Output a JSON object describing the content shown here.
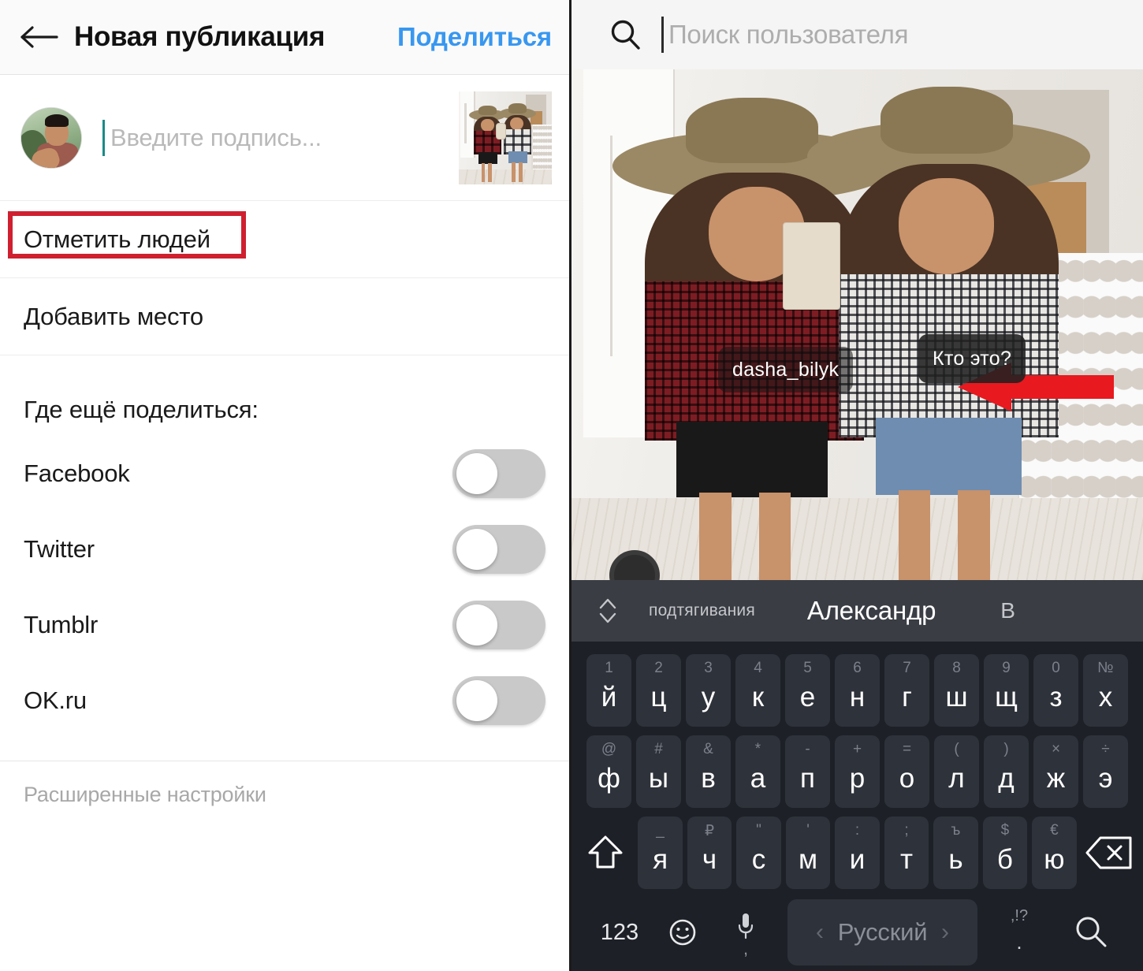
{
  "left": {
    "topbar": {
      "back_icon": "back-arrow-icon",
      "title": "Новая публикация",
      "share_label": "Поделиться"
    },
    "caption": {
      "avatar_name": "user-avatar",
      "placeholder": "Введите подпись...",
      "thumbnail_name": "post-thumbnail"
    },
    "menu": [
      {
        "label": "Отметить людей",
        "highlighted": true
      },
      {
        "label": "Добавить место",
        "highlighted": false
      }
    ],
    "share_section": {
      "label": "Где ещё поделиться:",
      "toggles": [
        {
          "label": "Facebook",
          "on": false
        },
        {
          "label": "Twitter",
          "on": false
        },
        {
          "label": "Tumblr",
          "on": false
        },
        {
          "label": "OK.ru",
          "on": false
        }
      ]
    },
    "advanced_label": "Расширенные настройки",
    "highlight_color": "#cf2030",
    "accent_color": "#3897f0"
  },
  "right": {
    "search": {
      "icon": "search-icon",
      "placeholder": "Поиск пользователя",
      "value": ""
    },
    "photo": {
      "tags": [
        {
          "label": "dasha_bilyk",
          "name": "photo-tag-dasha-bilyk"
        },
        {
          "label": "Кто это?",
          "name": "photo-tag-who-is-this"
        }
      ],
      "annotation": {
        "name": "red-arrow-annotation",
        "color": "#e8191f"
      }
    },
    "keyboard": {
      "suggestions": [
        {
          "text": "подтягивания"
        },
        {
          "text": "Александр"
        },
        {
          "text": "В"
        }
      ],
      "expand_icon": "chevron-up-down-icon",
      "rows": [
        [
          {
            "sup": "1",
            "main": "й"
          },
          {
            "sup": "2",
            "main": "ц"
          },
          {
            "sup": "3",
            "main": "у"
          },
          {
            "sup": "4",
            "main": "к"
          },
          {
            "sup": "5",
            "main": "е"
          },
          {
            "sup": "6",
            "main": "н"
          },
          {
            "sup": "7",
            "main": "г"
          },
          {
            "sup": "8",
            "main": "ш"
          },
          {
            "sup": "9",
            "main": "щ"
          },
          {
            "sup": "0",
            "main": "з"
          },
          {
            "sup": "№",
            "main": "х"
          }
        ],
        [
          {
            "sup": "@",
            "main": "ф"
          },
          {
            "sup": "#",
            "main": "ы"
          },
          {
            "sup": "&",
            "main": "в"
          },
          {
            "sup": "*",
            "main": "а"
          },
          {
            "sup": "-",
            "main": "п"
          },
          {
            "sup": "+",
            "main": "р"
          },
          {
            "sup": "=",
            "main": "о"
          },
          {
            "sup": "(",
            "main": "л"
          },
          {
            "sup": ")",
            "main": "д"
          },
          {
            "sup": "×",
            "main": "ж"
          },
          {
            "sup": "÷",
            "main": "э"
          }
        ],
        [
          {
            "sup": "_",
            "main": "я"
          },
          {
            "sup": "₽",
            "main": "ч"
          },
          {
            "sup": "\"",
            "main": "с"
          },
          {
            "sup": "'",
            "main": "м"
          },
          {
            "sup": ":",
            "main": "и"
          },
          {
            "sup": ";",
            "main": "т"
          },
          {
            "sup": "ъ",
            "main": "ь"
          },
          {
            "sup": "$",
            "main": "б"
          },
          {
            "sup": "€",
            "main": "ю"
          }
        ]
      ],
      "shift_icon": "shift-arrow-icon",
      "backspace_icon": "backspace-icon",
      "bottom": {
        "numeric_label": "123",
        "emoji_icon": "emoji-smiley-icon",
        "mic_icon": "microphone-icon",
        "mic_sub": ",",
        "space_label": "Русский",
        "prev_lang_icon": "chevron-left-icon",
        "next_lang_icon": "chevron-right-icon",
        "punct_top": ",!?",
        "punct_bottom": ".",
        "search_icon": "search-icon"
      }
    }
  }
}
